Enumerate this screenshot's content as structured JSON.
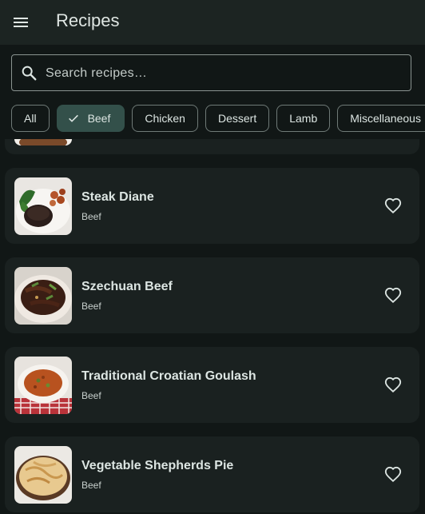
{
  "appbar": {
    "title": "Recipes",
    "menu_icon": "menu-icon"
  },
  "search": {
    "placeholder": "Search recipes…",
    "value": ""
  },
  "filters": {
    "chips": [
      "All",
      "Beef",
      "Chicken",
      "Dessert",
      "Lamb",
      "Miscellaneous"
    ],
    "selected": "Beef"
  },
  "recipes": [
    {
      "name": "",
      "category": ""
    },
    {
      "name": "Steak Diane",
      "category": "Beef"
    },
    {
      "name": "Szechuan Beef",
      "category": "Beef"
    },
    {
      "name": "Traditional Croatian Goulash",
      "category": "Beef"
    },
    {
      "name": "Vegetable Shepherds Pie",
      "category": "Beef"
    }
  ],
  "colors": {
    "background": "#111716",
    "appbar": "#1c2422",
    "card": "#1a2120",
    "selected_chip": "#33504a",
    "text": "#dce5e2"
  }
}
